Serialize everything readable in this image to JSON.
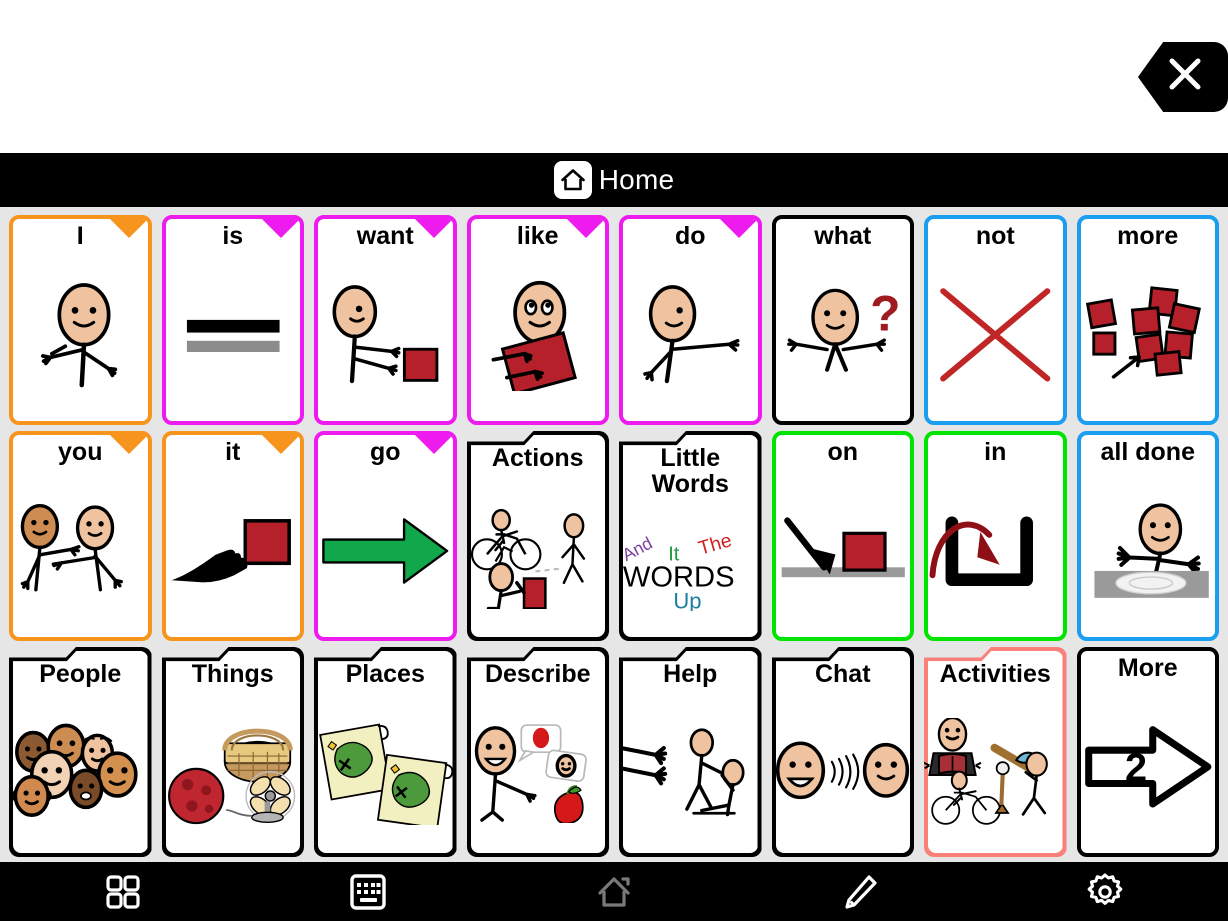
{
  "app": {
    "message_bar_text": "",
    "close_button_label": "close",
    "close_icon": "close-x-icon"
  },
  "header": {
    "title": "Home",
    "home_icon": "home-icon"
  },
  "grid": {
    "columns": 8,
    "rows": 3,
    "cells": [
      {
        "label": "I",
        "border": "#F7941E",
        "fold": "#F7941E",
        "type": "word",
        "art": "person-pointing-self"
      },
      {
        "label": "is",
        "border": "#ED1BED",
        "fold": "#ED1BED",
        "type": "word",
        "art": "equals-bars"
      },
      {
        "label": "want",
        "border": "#ED1BED",
        "fold": "#ED1BED",
        "type": "word",
        "art": "person-reaching-block"
      },
      {
        "label": "like",
        "border": "#ED1BED",
        "fold": "#ED1BED",
        "type": "word",
        "art": "person-hugging-block"
      },
      {
        "label": "do",
        "border": "#ED1BED",
        "fold": "#ED1BED",
        "type": "word",
        "art": "person-arm-out"
      },
      {
        "label": "what",
        "border": "#000000",
        "fold": null,
        "type": "word",
        "art": "person-question"
      },
      {
        "label": "not",
        "border": "#1B9DF0",
        "fold": null,
        "type": "word",
        "art": "red-x"
      },
      {
        "label": "more",
        "border": "#1B9DF0",
        "fold": null,
        "type": "word",
        "art": "blocks-more"
      },
      {
        "label": "you",
        "border": "#F7941E",
        "fold": "#F7941E",
        "type": "word",
        "art": "two-people-pointing"
      },
      {
        "label": "it",
        "border": "#F7941E",
        "fold": "#F7941E",
        "type": "word",
        "art": "hand-pointing-block"
      },
      {
        "label": "go",
        "border": "#ED1BED",
        "fold": "#ED1BED",
        "type": "word",
        "art": "green-arrow-right"
      },
      {
        "label": "Actions",
        "border": "#000000",
        "fold": null,
        "type": "folder",
        "art": "actions-people"
      },
      {
        "label": "Little\nWords",
        "border": "#000000",
        "fold": null,
        "type": "folder",
        "art": "little-words"
      },
      {
        "label": "on",
        "border": "#00E500",
        "fold": null,
        "type": "word",
        "art": "block-on-surface"
      },
      {
        "label": "in",
        "border": "#00E500",
        "fold": null,
        "type": "word",
        "art": "arrow-into-container"
      },
      {
        "label": "all done",
        "border": "#1B9DF0",
        "fold": null,
        "type": "word",
        "art": "person-empty-plate"
      },
      {
        "label": "People",
        "border": "#000000",
        "fold": null,
        "type": "folder",
        "art": "group-faces"
      },
      {
        "label": "Things",
        "border": "#000000",
        "fold": null,
        "type": "folder",
        "art": "ball-basket-fan"
      },
      {
        "label": "Places",
        "border": "#000000",
        "fold": null,
        "type": "folder",
        "art": "treasure-maps"
      },
      {
        "label": "Describe",
        "border": "#000000",
        "fold": null,
        "type": "folder",
        "art": "person-describing-apple"
      },
      {
        "label": "Help",
        "border": "#000000",
        "fold": null,
        "type": "folder",
        "art": "person-helping"
      },
      {
        "label": "Chat",
        "border": "#000000",
        "fold": null,
        "type": "folder",
        "art": "two-faces-talking"
      },
      {
        "label": "Activities",
        "border": "#F98179",
        "fold": null,
        "type": "folder",
        "art": "activities-sports"
      },
      {
        "label": "More",
        "border": "#000000",
        "fold": null,
        "type": "word",
        "art": "arrow-page-2",
        "art_text": "2"
      }
    ]
  },
  "toolbar": {
    "buttons": [
      {
        "name": "grid-icon",
        "label": "Grid"
      },
      {
        "name": "keyboard-icon",
        "label": "Keyboard"
      },
      {
        "name": "home-icon",
        "label": "Home"
      },
      {
        "name": "pencil-icon",
        "label": "Edit"
      },
      {
        "name": "gear-icon",
        "label": "Settings"
      }
    ]
  },
  "colors": {
    "pronoun": "#F7941E",
    "verb": "#ED1BED",
    "preposition": "#00E500",
    "social": "#1B9DF0",
    "question": "#000000",
    "selected": "#F98179",
    "background": "#E6E6E6",
    "bar": "#000000",
    "skin": "#EFC3A0",
    "block_red": "#B5202A"
  }
}
